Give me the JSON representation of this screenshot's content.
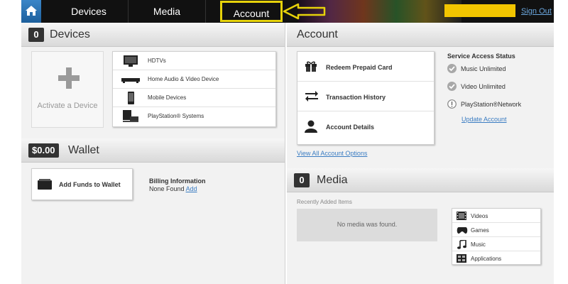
{
  "nav": {
    "tabs": [
      {
        "label": "Devices"
      },
      {
        "label": "Media"
      },
      {
        "label": "Account"
      }
    ],
    "sign_out": "Sign Out",
    "accent_color": "#e6d20a"
  },
  "devices": {
    "count": "0",
    "title": "Devices",
    "activate_label": "Activate a Device",
    "types": [
      {
        "label": "HDTVs",
        "icon": "tv-icon"
      },
      {
        "label": "Home Audio & Video Device",
        "icon": "av-receiver-icon"
      },
      {
        "label": "Mobile Devices",
        "icon": "mobile-device-icon"
      },
      {
        "label": "PlayStation® Systems",
        "icon": "playstation-icon"
      }
    ]
  },
  "wallet": {
    "balance": "$0.00",
    "title": "Wallet",
    "add_funds_label": "Add Funds to Wallet",
    "billing_title": "Billing Information",
    "billing_status": "None Found",
    "billing_add": "Add"
  },
  "account": {
    "title": "Account",
    "options": [
      {
        "label": "Redeem Prepaid Card",
        "icon": "gift-icon"
      },
      {
        "label": "Transaction History",
        "icon": "swap-arrows-icon"
      },
      {
        "label": "Account Details",
        "icon": "person-icon"
      }
    ],
    "view_all": "View All Account Options",
    "status_title": "Service Access Status",
    "services": [
      {
        "label": "Music Unlimited",
        "icon": "check-circle-icon"
      },
      {
        "label": "Video Unlimited",
        "icon": "check-circle-icon"
      },
      {
        "label": "PlayStation®Network",
        "icon": "alert-circle-icon"
      }
    ],
    "update_account": "Update Account"
  },
  "media": {
    "count": "0",
    "title": "Media",
    "recent_label": "Recently Added Items",
    "empty_message": "No media was found.",
    "categories": [
      {
        "label": "Videos",
        "icon": "film-icon"
      },
      {
        "label": "Games",
        "icon": "gamepad-icon"
      },
      {
        "label": "Music",
        "icon": "music-note-icon"
      },
      {
        "label": "Applications",
        "icon": "applications-icon"
      }
    ]
  }
}
